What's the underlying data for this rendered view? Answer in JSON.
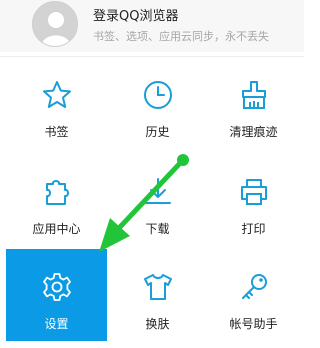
{
  "profile": {
    "title": "登录QQ浏览器",
    "subtitle": "书签、选项、应用云同步，永不丢失"
  },
  "colors": {
    "icon": "#1a9ed8",
    "active_bg": "#0b9ae6",
    "arrow": "#22c43a"
  },
  "menu": [
    {
      "label": "书签",
      "icon": "star-icon"
    },
    {
      "label": "历史",
      "icon": "clock-icon"
    },
    {
      "label": "清理痕迹",
      "icon": "broom-icon"
    },
    {
      "label": "应用中心",
      "icon": "puzzle-icon"
    },
    {
      "label": "下载",
      "icon": "download-icon"
    },
    {
      "label": "打印",
      "icon": "printer-icon"
    },
    {
      "label": "设置",
      "icon": "gear-icon",
      "selected": true
    },
    {
      "label": "换肤",
      "icon": "shirt-icon"
    },
    {
      "label": "帐号助手",
      "icon": "key-icon"
    }
  ]
}
